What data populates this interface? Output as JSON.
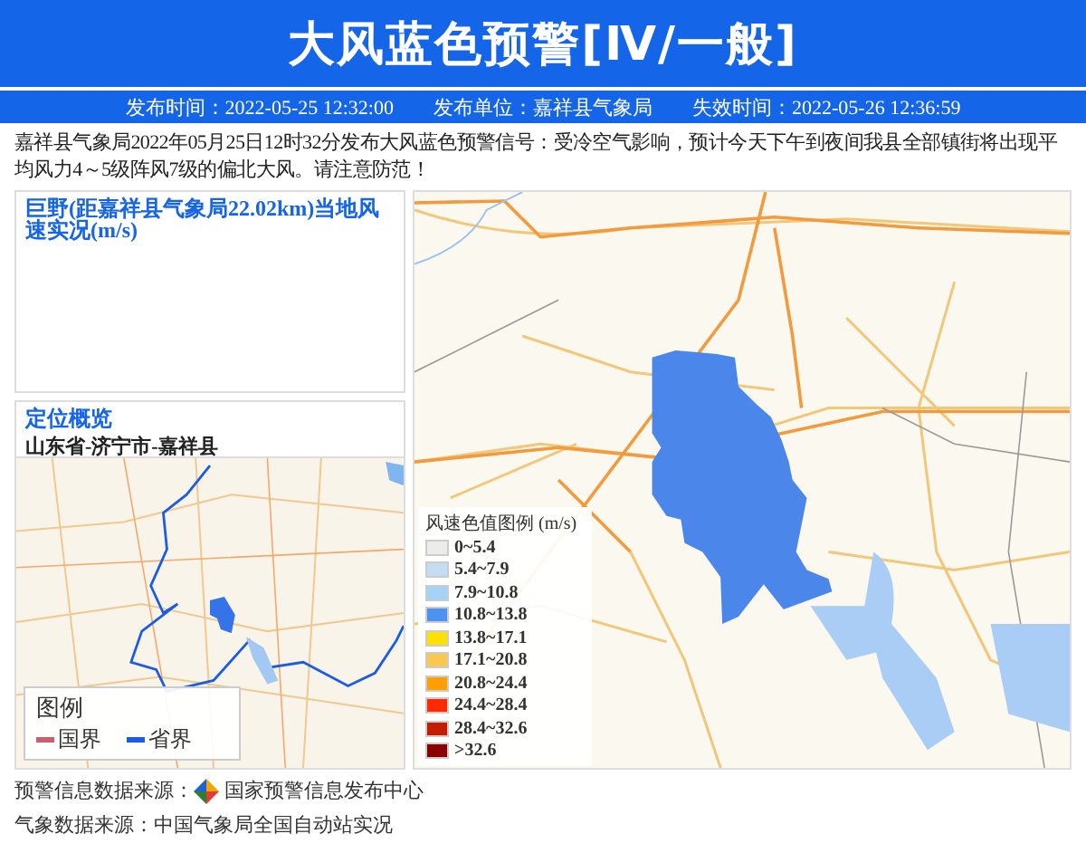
{
  "header": {
    "title": "大风蓝色预警[Ⅳ/一般]"
  },
  "info_bar": [
    {
      "label": "发布时间：",
      "value": "2022-05-25 12:32:00"
    },
    {
      "label": "发布单位：",
      "value": "嘉祥县气象局"
    },
    {
      "label": "失效时间：",
      "value": "2022-05-26 12:36:59"
    }
  ],
  "description": "嘉祥县气象局2022年05月25日12时32分发布大风蓝色预警信号：受冷空气影响，预计今天下午到夜间我县全部镇街将出现平均风力4～5级阵风7级的偏北大风。请注意防范！",
  "wind_panel": {
    "title": "巨野(距嘉祥县气象局22.02km)当地风速实况(m/s)"
  },
  "location_panel": {
    "title": "定位概览",
    "path": "山东省-济宁市-嘉祥县",
    "legend": {
      "title": "图例",
      "items": [
        {
          "label": "国界",
          "color": "#c8606e"
        },
        {
          "label": "省界",
          "color": "#1a5ce6"
        }
      ]
    }
  },
  "wind_legend": {
    "title": "风速色值图例 (m/s)",
    "items": [
      {
        "label": "0~5.4",
        "color": "#ececec"
      },
      {
        "label": "5.4~7.9",
        "color": "#c4ddf3"
      },
      {
        "label": "7.9~10.8",
        "color": "#a3d3f7"
      },
      {
        "label": "10.8~13.8",
        "color": "#4d92f0"
      },
      {
        "label": "13.8~17.1",
        "color": "#ffe100"
      },
      {
        "label": "17.1~20.8",
        "color": "#f8c850"
      },
      {
        "label": "20.8~24.4",
        "color": "#ffa000"
      },
      {
        "label": "24.4~28.4",
        "color": "#ff2a00"
      },
      {
        "label": "28.4~32.6",
        "color": "#c41c00"
      },
      {
        "label": ">32.6",
        "color": "#8a0000"
      }
    ]
  },
  "footer": [
    {
      "label": "预警信息数据来源：",
      "source": "国家预警信息发布中心",
      "logo": true
    },
    {
      "label": "气象数据来源：",
      "source": "中国气象局全国自动站实况",
      "logo": false
    }
  ]
}
